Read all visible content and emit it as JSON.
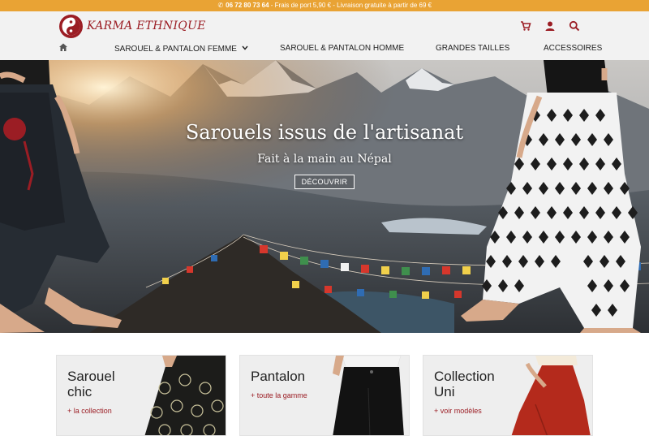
{
  "topbar": {
    "phone": "06 72 80 73 64",
    "shipping": " - Frais de port 5,90 € - Livraison gratuite à partir de 69 €"
  },
  "header": {
    "logo_text": "KARMA ETHNIQUE",
    "icons": [
      "cart-icon",
      "user-icon",
      "search-icon"
    ]
  },
  "nav": {
    "home_icon": "home-icon",
    "items": [
      {
        "label": "SAROUEL & PANTALON FEMME",
        "has_dropdown": true
      },
      {
        "label": "SAROUEL & PANTALON HOMME"
      },
      {
        "label": "GRANDES TAILLES"
      },
      {
        "label": "ACCESSOIRES"
      }
    ]
  },
  "hero": {
    "title": "Sarouels issus de l'artisanat",
    "subtitle": "Fait à la main au Népal",
    "button": "DÉCOUVRIR"
  },
  "cards": [
    {
      "title": "Sarouel chic",
      "link": "+ la collection"
    },
    {
      "title": "Pantalon",
      "link": "+ toute la gamme"
    },
    {
      "title": "Collection Uni",
      "link": "+ voir modèles"
    }
  ],
  "colors": {
    "topbar": "#e9a334",
    "brand": "#9b1d24",
    "header_bg": "#f2f2f2",
    "card_bg": "#eeeeee"
  }
}
